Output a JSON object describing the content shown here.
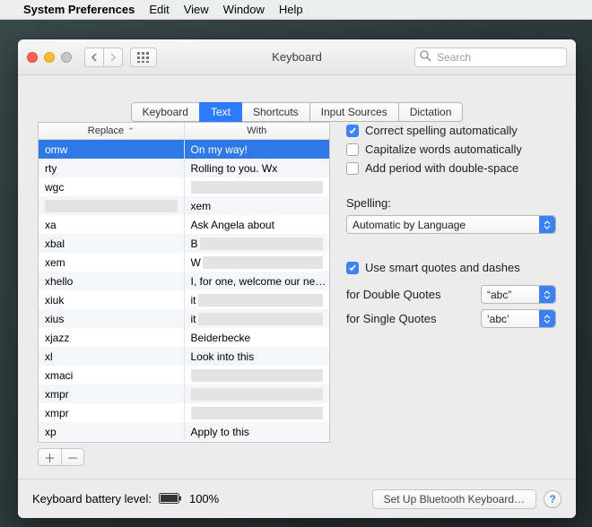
{
  "menubar": {
    "app_name": "System Preferences",
    "items": [
      "Edit",
      "View",
      "Window",
      "Help"
    ]
  },
  "window": {
    "title": "Keyboard",
    "search_placeholder": "Search"
  },
  "tabs": [
    "Keyboard",
    "Text",
    "Shortcuts",
    "Input Sources",
    "Dictation"
  ],
  "active_tab_index": 1,
  "table": {
    "columns": [
      "Replace",
      "With"
    ],
    "rows": [
      {
        "replace": "omw",
        "with": "On my way!",
        "selected": true
      },
      {
        "replace": "rty",
        "with": "Rolling to you. Wx"
      },
      {
        "replace": "wgc",
        "with": "",
        "redacted": true
      },
      {
        "replace": "",
        "with": "xem",
        "replace_redacted": true
      },
      {
        "replace": "xa",
        "with": "Ask Angela about"
      },
      {
        "replace": "xbal",
        "with": "B",
        "redacted_tail": true
      },
      {
        "replace": "xem",
        "with": "W",
        "redacted_tail": true
      },
      {
        "replace": "xhello",
        "with": "I, for one, welcome our ne…"
      },
      {
        "replace": "xiuk",
        "with": "it",
        "redacted_tail": true
      },
      {
        "replace": "xius",
        "with": "it",
        "redacted_tail": true
      },
      {
        "replace": "xjazz",
        "with": "Beiderbecke"
      },
      {
        "replace": "xl",
        "with": "Look into this"
      },
      {
        "replace": "xmaci",
        "with": "",
        "redacted": true
      },
      {
        "replace": "xmpr",
        "with": "",
        "redacted": true
      },
      {
        "replace": "xmpr",
        "with": "",
        "redacted": true
      },
      {
        "replace": "xp",
        "with": "Apply to this"
      }
    ]
  },
  "options": {
    "correct_spelling": {
      "label": "Correct spelling automatically",
      "checked": true
    },
    "capitalize": {
      "label": "Capitalize words automatically",
      "checked": false
    },
    "add_period": {
      "label": "Add period with double-space",
      "checked": false
    },
    "spelling_label": "Spelling:",
    "spelling_value": "Automatic by Language",
    "smart_quotes": {
      "label": "Use smart quotes and dashes",
      "checked": true
    },
    "double_label": "for Double Quotes",
    "double_value": "“abc”",
    "single_label": "for Single Quotes",
    "single_value": "‘abc’"
  },
  "footer": {
    "battery_label": "Keyboard battery level:",
    "battery_pct": "100%",
    "bluetooth_btn": "Set Up Bluetooth Keyboard…"
  },
  "buttons": {
    "add": "＋",
    "remove": "－"
  }
}
